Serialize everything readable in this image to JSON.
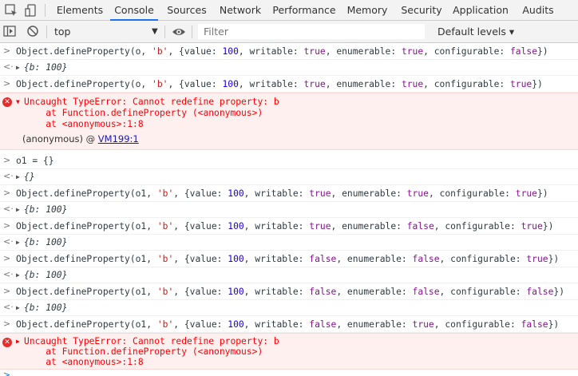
{
  "tabs": [
    {
      "label": "Elements"
    },
    {
      "label": "Console"
    },
    {
      "label": "Sources"
    },
    {
      "label": "Network"
    },
    {
      "label": "Performance"
    },
    {
      "label": "Memory"
    },
    {
      "label": "Security"
    },
    {
      "label": "Application"
    },
    {
      "label": "Audits"
    }
  ],
  "toolbar": {
    "context": "top",
    "filter_placeholder": "Filter",
    "levels": "Default levels ▾"
  },
  "console": {
    "r1": {
      "a": "Object.defineProperty(o, ",
      "b": "'b'",
      "c": ", {value: ",
      "d": "100",
      "e": ", writable: ",
      "f": "true",
      "g": ", enumerable: ",
      "h": "true",
      "i": ", configurable: ",
      "j": "false",
      "k": "})"
    },
    "r1_out": "{b: 100}",
    "r2": {
      "a": "Object.defineProperty(o, ",
      "b": "'b'",
      "c": ", {value: ",
      "d": "100",
      "e": ", writable: ",
      "f": "true",
      "g": ", enumerable: ",
      "h": "true",
      "i": ", configurable: ",
      "j": "true",
      "k": "})"
    },
    "err1": {
      "l1": "Uncaught TypeError: Cannot redefine property: b",
      "l2": "    at Function.defineProperty (<anonymous>)",
      "l3": "    at <anonymous>:1:8",
      "l4a": "(anonymous) @ ",
      "l4b": "VM199:1"
    },
    "r3": "o1 = {}",
    "r3_out": "{}",
    "r4": {
      "a": "Object.defineProperty(o1, ",
      "b": "'b'",
      "c": ", {value: ",
      "d": "100",
      "e": ", writable: ",
      "f": "true",
      "g": ", enumerable: ",
      "h": "true",
      "i": ", configurable: ",
      "j": "true",
      "k": "})"
    },
    "r4_out": "{b: 100}",
    "r5": {
      "a": "Object.defineProperty(o1, ",
      "b": "'b'",
      "c": ", {value: ",
      "d": "100",
      "e": ", writable: ",
      "f": "true",
      "g": ", enumerable: ",
      "h": "false",
      "i": ", configurable: ",
      "j": "true",
      "k": "})"
    },
    "r5_out": "{b: 100}",
    "r6": {
      "a": "Object.defineProperty(o1, ",
      "b": "'b'",
      "c": ", {value: ",
      "d": "100",
      "e": ", writable: ",
      "f": "false",
      "g": ", enumerable: ",
      "h": "false",
      "i": ", configurable: ",
      "j": "true",
      "k": "})"
    },
    "r6_out": "{b: 100}",
    "r7": {
      "a": "Object.defineProperty(o1, ",
      "b": "'b'",
      "c": ", {value: ",
      "d": "100",
      "e": ", writable: ",
      "f": "false",
      "g": ", enumerable: ",
      "h": "false",
      "i": ", configurable: ",
      "j": "false",
      "k": "})"
    },
    "r7_out": "{b: 100}",
    "r8": {
      "a": "Object.defineProperty(o1, ",
      "b": "'b'",
      "c": ", {value: ",
      "d": "100",
      "e": ", writable: ",
      "f": "false",
      "g": ", enumerable: ",
      "h": "true",
      "i": ", configurable: ",
      "j": "false",
      "k": "})"
    },
    "err2": {
      "l1": "Uncaught TypeError: Cannot redefine property: b",
      "l2": "    at Function.defineProperty (<anonymous>)",
      "l3": "    at <anonymous>:1:8"
    }
  }
}
